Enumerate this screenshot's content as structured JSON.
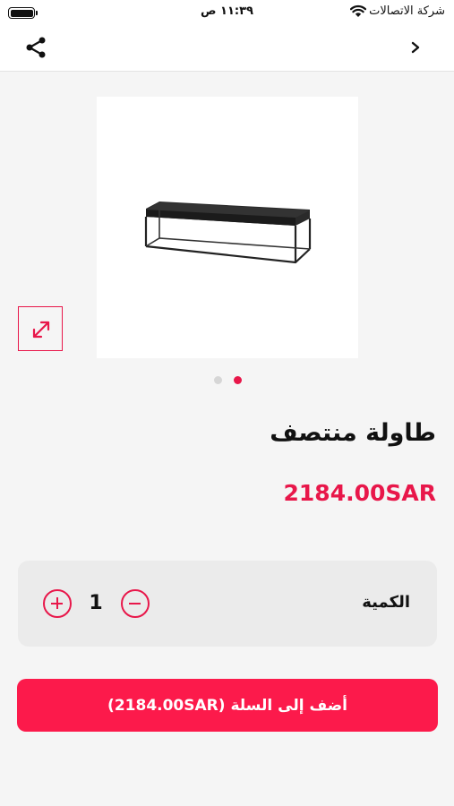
{
  "status_bar": {
    "carrier": "شركة الاتصالات",
    "time": "١١:٣٩ ص"
  },
  "nav": {
    "share_icon": "share-icon",
    "back_icon": "chevron-right-icon"
  },
  "product": {
    "image_icon": "coffee-table-image",
    "expand_icon": "expand-arrows-icon",
    "carousel": {
      "page_count": 2,
      "active_index": 1
    },
    "title": "طاولة منتصف",
    "price": "2184.00SAR"
  },
  "quantity": {
    "label": "الكمية",
    "value": "1",
    "minus_icon": "minus-circle-icon",
    "plus_icon": "plus-circle-icon"
  },
  "cart": {
    "add_label": "أضف إلى السلة (2184.00SAR)"
  },
  "colors": {
    "accent": "#e8174a",
    "button": "#fc1a4b",
    "background": "#f5f5f5",
    "card": "#ebebeb"
  }
}
